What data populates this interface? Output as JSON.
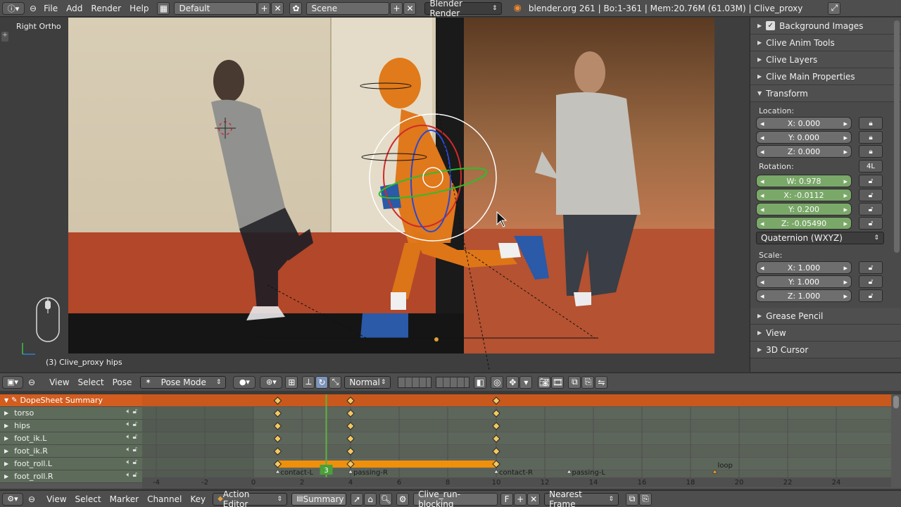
{
  "topbar": {
    "menus": [
      "File",
      "Add",
      "Render",
      "Help"
    ],
    "layout": "Default",
    "scene": "Scene",
    "engine": "Blender Render",
    "stats": "blender.org 261 | Bo:1-361 | Mem:20.76M (61.03M) | Clive_proxy"
  },
  "viewport": {
    "view_name": "Right Ortho",
    "object_label": "(3) Clive_proxy hips"
  },
  "properties": {
    "panels_top": [
      "Background Images",
      "Clive Anim Tools",
      "Clive Layers",
      "Clive Main Properties",
      "Transform"
    ],
    "location_label": "Location:",
    "location": [
      "X: 0.000",
      "Y: 0.000",
      "Z: 0.000"
    ],
    "rotation_label": "Rotation:",
    "rotation_lock_label": "4L",
    "rotation": [
      "W: 0.978",
      "X: -0.0112",
      "Y: 0.200",
      "Z: -0.05490"
    ],
    "rotation_mode": "Quaternion (WXYZ)",
    "scale_label": "Scale:",
    "scale": [
      "X: 1.000",
      "Y: 1.000",
      "Z: 1.000"
    ],
    "panels_bottom": [
      "Grease Pencil",
      "View",
      "3D Cursor"
    ]
  },
  "header3d": {
    "menus": [
      "View",
      "Select",
      "Pose"
    ],
    "mode": "Pose Mode",
    "orientation": "Normal"
  },
  "dopesheet": {
    "channels": [
      "DopeSheet Summary",
      "torso",
      "hips",
      "foot_ik.L",
      "foot_ik.R",
      "foot_roll.L",
      "foot_roll.R"
    ],
    "current_frame": "3",
    "keyframes": [
      1,
      4,
      10
    ],
    "markers": [
      {
        "frame": 1,
        "label": "contact-L"
      },
      {
        "frame": 4,
        "label": "passing-R"
      },
      {
        "frame": 10,
        "label": "contact-R"
      },
      {
        "frame": 13,
        "label": "passing-L"
      },
      {
        "frame": 19,
        "label": "loop"
      }
    ],
    "ruler": [
      "-4",
      "-2",
      "0",
      "2",
      "4",
      "6",
      "8",
      "10",
      "12",
      "14",
      "16",
      "18",
      "20",
      "22",
      "24"
    ]
  },
  "header_ds": {
    "menus": [
      "View",
      "Select",
      "Marker",
      "Channel",
      "Key"
    ],
    "editor_mode": "Action Editor",
    "summary_label": "Summary",
    "action_name": "Clive_run-blocking",
    "fake_user": "F",
    "snap_mode": "Nearest Frame"
  }
}
